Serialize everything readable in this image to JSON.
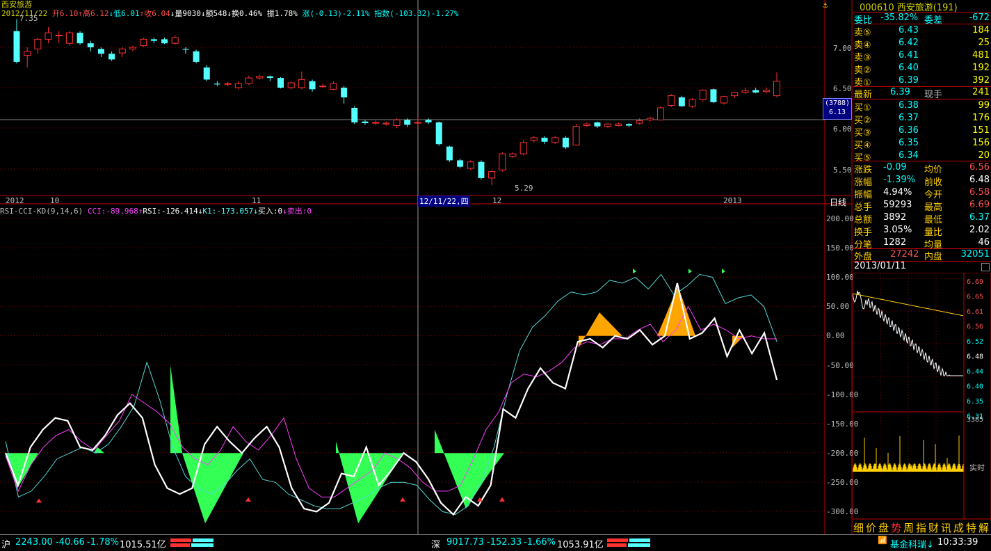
{
  "stock": {
    "code": "000610",
    "name": "西安旅游",
    "suffix": "(191)"
  },
  "kline_title": "西安旅游",
  "info_bar": {
    "date": "2012/11/22",
    "open": "开6.10",
    "high": "↑高6.12",
    "low": "↓低6.01",
    "close": "↑收6.04",
    "vol": "↓量9030",
    "amount": "↓额548",
    "turnover": "↓换0.46%",
    "amplitude": "振1.78%",
    "change": "涨(-0.13)-2.11%",
    "index": "指数(-103.32)-1.27%"
  },
  "price_axis": [
    "7.00",
    "6.50",
    "6.00",
    "5.50"
  ],
  "price_marks": {
    "high": "7.35",
    "low": "5.29"
  },
  "cursor_price": {
    "num": "(3788)",
    "price": "6.13"
  },
  "time_axis": {
    "labels": [
      "2012",
      "10",
      "11",
      "12",
      "2013"
    ],
    "cursor_date": "12/11/22,四",
    "period": "日线"
  },
  "indicator": {
    "name": "RSI-CCI-KD(9,14,6)",
    "cci": "CCI:-89.968↑",
    "rsi": "RSI:-126.414↓",
    "k1": "K1:-173.057↓",
    "buy": "买入:0",
    "sell": "↓卖出:0",
    "axis": [
      "200.00",
      "150.00",
      "100.00",
      "50.00",
      "0.00",
      "-50.00",
      "-100.00",
      "-150.00",
      "-200.00",
      "-250.00",
      "-300.00"
    ]
  },
  "quote": {
    "webi_label": "委比",
    "webi_val": "-35.82%",
    "weicha_label": "委差",
    "weicha_val": "-672",
    "sells": [
      {
        "label": "卖⑤",
        "price": "6.43",
        "vol": "184"
      },
      {
        "label": "卖④",
        "price": "6.42",
        "vol": "25"
      },
      {
        "label": "卖③",
        "price": "6.41",
        "vol": "481"
      },
      {
        "label": "卖②",
        "price": "6.40",
        "vol": "192"
      },
      {
        "label": "卖①",
        "price": "6.39",
        "vol": "392"
      }
    ],
    "latest_label": "最新",
    "latest_val": "6.39",
    "xianshou_label": "现手",
    "xianshou_val": "241",
    "buys": [
      {
        "label": "买①",
        "price": "6.38",
        "vol": "99"
      },
      {
        "label": "买②",
        "price": "6.37",
        "vol": "176"
      },
      {
        "label": "买③",
        "price": "6.36",
        "vol": "151"
      },
      {
        "label": "买④",
        "price": "6.35",
        "vol": "156"
      },
      {
        "label": "买⑤",
        "price": "6.34",
        "vol": "20"
      }
    ],
    "stats": [
      {
        "l1": "涨跌",
        "v1": "-0.09",
        "l2": "均价",
        "v2": "6.56",
        "c1": "#00ffff",
        "c2": "#ff5050"
      },
      {
        "l1": "涨幅",
        "v1": "-1.39%",
        "l2": "前收",
        "v2": "6.48",
        "c1": "#00ffff",
        "c2": "#ffffff"
      },
      {
        "l1": "振幅",
        "v1": "4.94%",
        "l2": "今开",
        "v2": "6.58",
        "c1": "#ffffff",
        "c2": "#ff5050"
      },
      {
        "l1": "总手",
        "v1": "59293",
        "l2": "最高",
        "v2": "6.69",
        "c1": "#ffffff",
        "c2": "#ff5050"
      },
      {
        "l1": "总额",
        "v1": "3892",
        "l2": "最低",
        "v2": "6.37",
        "c1": "#ffffff",
        "c2": "#00ffff"
      },
      {
        "l1": "换手",
        "v1": "3.05%",
        "l2": "量比",
        "v2": "2.02",
        "c1": "#ffffff",
        "c2": "#ffffff"
      },
      {
        "l1": "分笔",
        "v1": "1282",
        "l2": "均量",
        "v2": "46",
        "c1": "#ffffff",
        "c2": "#ffffff"
      }
    ],
    "waipan_label": "外盘",
    "waipan_val": "27242",
    "neipan_label": "内盘",
    "neipan_val": "32051"
  },
  "intraday": {
    "date": "2013/01/11",
    "price_axis": [
      "6.69",
      "6.65",
      "6.61",
      "6.56",
      "6.52",
      "6.48",
      "6.44",
      "6.40",
      "6.35",
      "6.31"
    ],
    "vol_max": "3385",
    "mode": "实时"
  },
  "bottom_tabs": [
    "细",
    "价",
    "盘",
    "势",
    "周",
    "指",
    "财",
    "讯",
    "成",
    "特",
    "解"
  ],
  "statusbar": {
    "sh_label": "沪",
    "sh_index": "2243.00",
    "sh_chg": "-40.66",
    "sh_pct": "-1.78%",
    "sh_amt": "1015.51亿",
    "sz_label": "深",
    "sz_index": "9017.73",
    "sz_chg": "-152.33",
    "sz_pct": "-1.66%",
    "sz_amt": "1053.91亿",
    "fund": "基金科瑞↓",
    "time": "10:33:39"
  },
  "colors": {
    "up": "#ff3232",
    "down": "#54ffff",
    "grid": "#8b0000",
    "axis": "#c00000",
    "cursor": "#ffffff"
  }
}
